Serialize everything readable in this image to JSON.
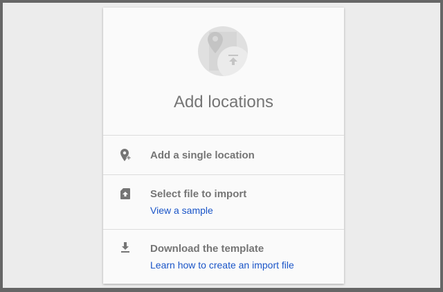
{
  "card": {
    "title": "Add locations",
    "options": [
      {
        "label": "Add a single location",
        "icon": "add-location-icon"
      },
      {
        "label": "Select file to import",
        "link": "View a sample",
        "icon": "file-upload-icon"
      },
      {
        "label": "Download the template",
        "link": "Learn how to create an import file",
        "icon": "download-icon"
      }
    ]
  }
}
